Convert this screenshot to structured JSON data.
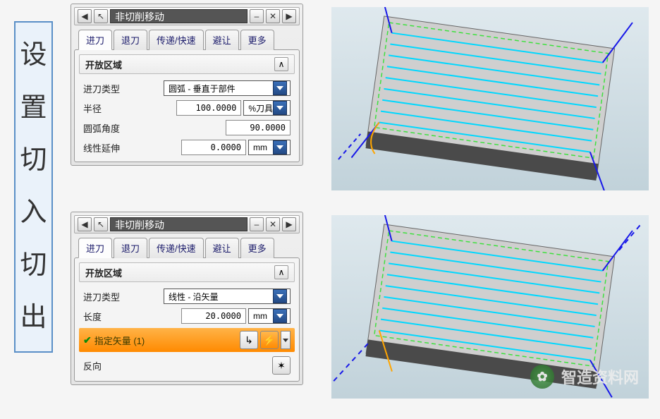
{
  "side_title": [
    "设",
    "置",
    "切",
    "入",
    "切",
    "出"
  ],
  "dlg1": {
    "title": "非切削移动",
    "tabs": [
      "进刀",
      "退刀",
      "传递/快速",
      "避让",
      "更多"
    ],
    "active_tab": 0,
    "section": "开放区域",
    "rows": {
      "type_label": "进刀类型",
      "type_value": "圆弧 - 垂直于部件",
      "radius_label": "半径",
      "radius_value": "100.0000",
      "radius_unit": "%刀具",
      "arc_label": "圆弧角度",
      "arc_value": "90.0000",
      "ext_label": "线性延伸",
      "ext_value": "0.0000",
      "ext_unit": "mm"
    }
  },
  "dlg2": {
    "title": "非切削移动",
    "tabs": [
      "进刀",
      "退刀",
      "传递/快速",
      "避让",
      "更多"
    ],
    "active_tab": 0,
    "section": "开放区域",
    "rows": {
      "type_label": "进刀类型",
      "type_value": "线性 - 沿矢量",
      "len_label": "长度",
      "len_value": "20.0000",
      "len_unit": "mm",
      "vec_label": "指定矢量 (1)",
      "rev_label": "反向"
    }
  },
  "watermark": "智造资料网"
}
